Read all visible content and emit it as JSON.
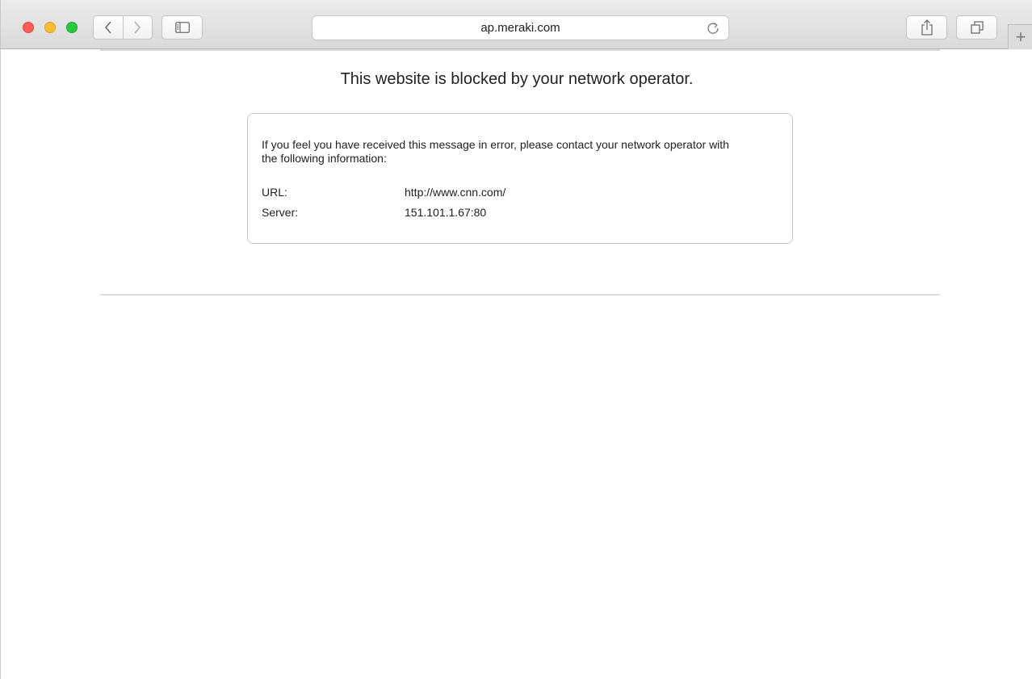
{
  "browser": {
    "address": "ap.meraki.com",
    "icons": {
      "back": "chevron-left-icon",
      "forward": "chevron-right-icon",
      "sidebar": "sidebar-icon",
      "reload": "reload-icon",
      "share": "share-icon",
      "tabs": "tabs-overview-icon",
      "new_tab": "plus-icon"
    },
    "traffic_colors": {
      "close": "#fc5f57",
      "minimize": "#fdbc2e",
      "maximize": "#28c840"
    }
  },
  "page": {
    "heading": "This website is blocked by your network operator.",
    "message": "If you feel you have received this message in error, please contact your network operator with the following information:",
    "details": [
      {
        "label": "URL:",
        "value": "http://www.cnn.com/"
      },
      {
        "label": "Server:",
        "value": "151.101.1.67:80"
      }
    ]
  }
}
